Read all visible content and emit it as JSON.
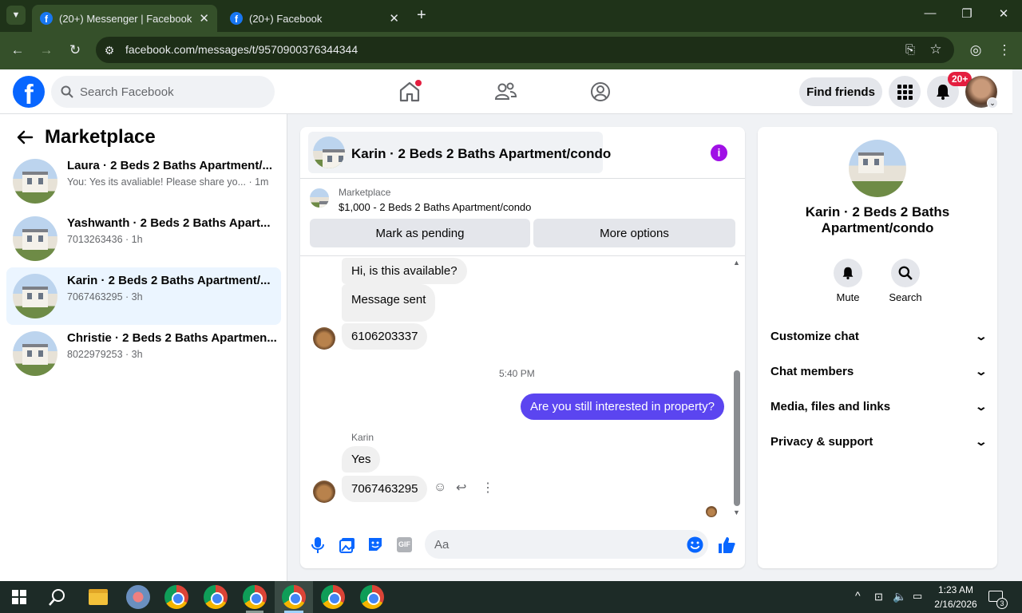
{
  "browser": {
    "tabs": [
      {
        "title": "(20+) Messenger | Facebook",
        "active": true
      },
      {
        "title": "(20+) Facebook",
        "active": false
      }
    ],
    "url": "facebook.com/messages/t/9570900376344344"
  },
  "header": {
    "search_placeholder": "Search Facebook",
    "find_friends": "Find friends",
    "notification_badge": "20+"
  },
  "sidebar": {
    "title": "Marketplace",
    "conversations": [
      {
        "name": "Laura · 2 Beds 2 Baths Apartment/...",
        "subtitle": "You: Yes its avaliable! Please share yo... · 1m",
        "selected": false
      },
      {
        "name": "Yashwanth · 2 Beds 2 Baths Apart...",
        "subtitle": "7013263436 · 1h",
        "selected": false
      },
      {
        "name": "Karin · 2 Beds 2 Baths Apartment/...",
        "subtitle": "7067463295 · 3h",
        "selected": true
      },
      {
        "name": "Christie · 2 Beds 2 Baths Apartmen...",
        "subtitle": "8022979253 · 3h",
        "selected": false
      }
    ]
  },
  "chat": {
    "title": "Karin · 2 Beds 2 Baths Apartment/condo",
    "marketplace_label": "Marketplace",
    "listing": "$1,000 - 2 Beds 2 Baths Apartment/condo",
    "mark_pending": "Mark as pending",
    "more_options": "More options",
    "messages": {
      "m1": "Hi, is this available?",
      "m2": "Message sent",
      "m3": "6106203337",
      "timestamp": "5:40 PM",
      "m4": "Are you still interested in property?",
      "sender": "Karin",
      "m5": "Yes",
      "m6": "7067463295"
    },
    "composer_placeholder": "Aa"
  },
  "details": {
    "title": "Karin · 2 Beds 2 Baths Apartment/condo",
    "mute": "Mute",
    "search": "Search",
    "sections": [
      "Customize chat",
      "Chat members",
      "Media, files and links",
      "Privacy & support"
    ]
  },
  "taskbar": {
    "time": "1:23 AM",
    "date": "2/16/2026",
    "notifications": "3"
  },
  "colors": {
    "accent": "#0866ff",
    "outgoing_bubble": "#5b45f0",
    "selected_row": "#ebf5ff",
    "info_button": "#a010e6"
  }
}
